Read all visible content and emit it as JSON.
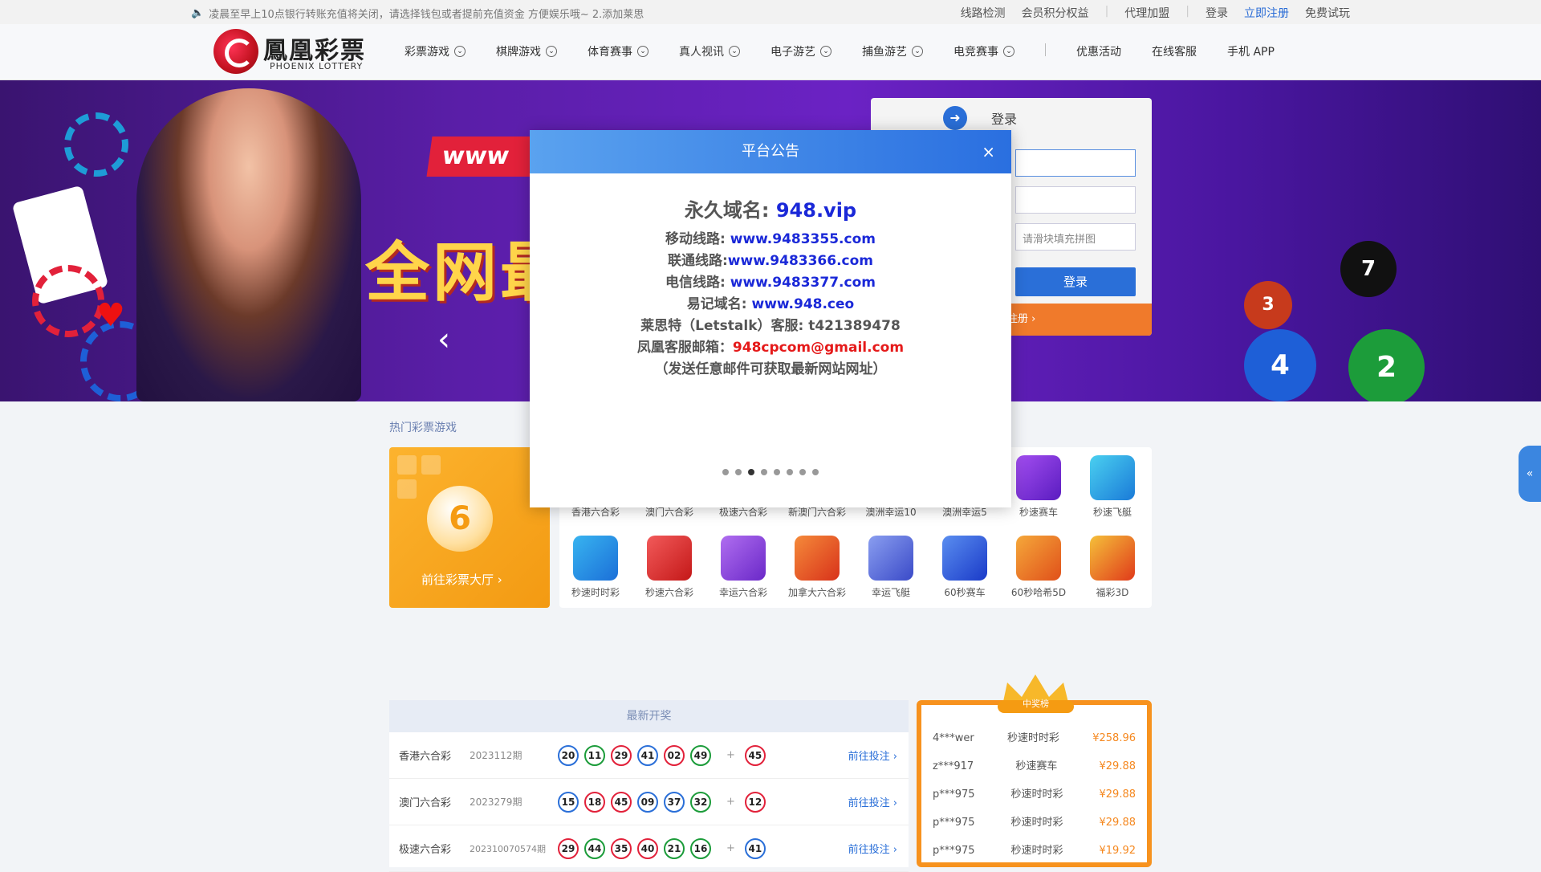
{
  "topbar": {
    "notice": "凌晨至早上10点银行转账充值将关闭，请选择钱包或者提前充值资金 方便娱乐哦~ 2.添加莱思",
    "links": [
      "线路检测",
      "会员积分权益",
      "代理加盟",
      "登录",
      "立即注册",
      "免费试玩"
    ]
  },
  "logo": {
    "cn": "鳳凰彩票",
    "en": "PHOENIX LOTTERY"
  },
  "nav": {
    "items": [
      "彩票游戏",
      "棋牌游戏",
      "体育赛事",
      "真人视讯",
      "电子游艺",
      "捕鱼游艺",
      "电竞赛事"
    ],
    "extra": [
      "优惠活动",
      "在线客服",
      "手机 APP"
    ]
  },
  "banner": {
    "www": "www",
    "slogan": "全网最"
  },
  "login": {
    "title": "登录",
    "slider_hint": "请滑块填充拼图",
    "button": "登录",
    "footer": "注册 ›"
  },
  "hot": {
    "title": "热门彩票游戏",
    "go_hall": "前往彩票大厅  ›",
    "ball_number": "6",
    "row1": [
      "香港六合彩",
      "澳门六合彩",
      "极速六合彩",
      "新澳门六合彩",
      "澳洲幸运10",
      "澳洲幸运5",
      "秒速赛车",
      "秒速飞艇"
    ],
    "row2": [
      "秒速时时彩",
      "秒速六合彩",
      "幸运六合彩",
      "加拿大六合彩",
      "幸运飞艇",
      "60秒赛车",
      "60秒哈希5D",
      "福彩3D"
    ]
  },
  "draws": {
    "title": "最新开奖",
    "go_label": "前往投注 ›",
    "rows": [
      {
        "name": "香港六合彩",
        "period": "2023112期",
        "nums": [
          "20",
          "11",
          "29",
          "41",
          "02",
          "49"
        ],
        "special": "45"
      },
      {
        "name": "澳门六合彩",
        "period": "2023279期",
        "nums": [
          "15",
          "18",
          "45",
          "09",
          "37",
          "32"
        ],
        "special": "12"
      },
      {
        "name": "极速六合彩",
        "period": "202310070574期",
        "nums": [
          "29",
          "44",
          "35",
          "40",
          "21",
          "16"
        ],
        "special": "41"
      }
    ]
  },
  "winners": {
    "title": "中奖榜",
    "rows": [
      {
        "user": "4***wer",
        "game": "秒速时时彩",
        "amount": "¥258.96"
      },
      {
        "user": "z***917",
        "game": "秒速赛车",
        "amount": "¥29.88"
      },
      {
        "user": "p***975",
        "game": "秒速时时彩",
        "amount": "¥29.88"
      },
      {
        "user": "p***975",
        "game": "秒速时时彩",
        "amount": "¥29.88"
      },
      {
        "user": "p***975",
        "game": "秒速时时彩",
        "amount": "¥19.92"
      }
    ]
  },
  "side_tab": "«",
  "modal": {
    "title": "平台公告",
    "close": "×",
    "line1_label": "永久域名: ",
    "line1_value": "948.vip",
    "lines": [
      {
        "label": "移动线路: ",
        "value": "www.9483355.com"
      },
      {
        "label": "联通线路:",
        "value": "www.9483366.com"
      },
      {
        "label": "电信线路: ",
        "value": "www.9483377.com"
      },
      {
        "label": "易记域名: ",
        "value": "www.948.ceo"
      }
    ],
    "letstalk": "莱思特（Letstalk）客服: t421389478",
    "email_label": "凤凰客服邮箱：",
    "email_value": "948cpcom@gmail.com",
    "email_note": "（发送任意邮件可获取最新网站网址）",
    "dots": 8,
    "active_dot": 3
  },
  "colors": {
    "accent": "#2a6fd8",
    "orange": "#f7921e",
    "link_blue": "#1a28d8",
    "email_red": "#e51a1a"
  }
}
